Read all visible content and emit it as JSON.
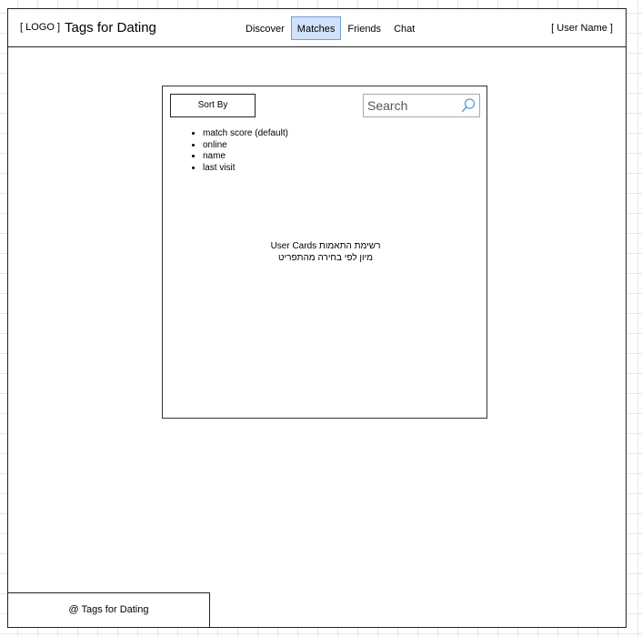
{
  "header": {
    "logo": "[ LOGO ]",
    "site_title": "Tags for Dating",
    "user_name": "[ User Name ]",
    "nav": [
      {
        "label": "Discover",
        "active": false
      },
      {
        "label": "Matches",
        "active": true
      },
      {
        "label": "Friends",
        "active": false
      },
      {
        "label": "Chat",
        "active": false
      }
    ]
  },
  "matches": {
    "sort_button_label": "Sort By",
    "search_placeholder": "Search",
    "search_value": "",
    "sort_options": [
      "match score (default)",
      "online",
      "name",
      "last visit"
    ],
    "cards_placeholder_line1": "רשימת התאמות User Cards",
    "cards_placeholder_line2": "מיון לפי בחירה מהתפריט"
  },
  "footer": {
    "text": "@ Tags for Dating"
  },
  "colors": {
    "active_tab_background": "#cfe2fa",
    "active_tab_border": "#6f9fd8",
    "search_icon": "#5b9bd5"
  },
  "icons": {
    "search": "search-icon"
  }
}
